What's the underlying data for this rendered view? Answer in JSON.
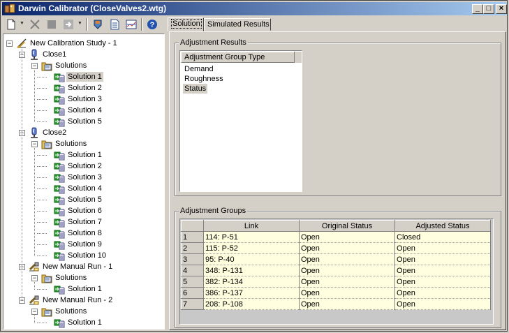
{
  "window": {
    "title": "Darwin Calibrator (CloseValves2.wtg)",
    "minimize": "_",
    "maximize": "□",
    "close": "×"
  },
  "toolbar": {
    "icons": [
      "new-document-icon",
      "new-dropdown-arrow-icon",
      "delete-icon",
      "stop-icon",
      "export-icon",
      "export-dropdown-arrow-icon",
      "compute-icon",
      "report-icon",
      "graph-icon",
      "help-icon"
    ]
  },
  "tree": {
    "root": "New Calibration Study - 1",
    "close1": "Close1",
    "close1_solutions": "Solutions",
    "close1_items": [
      "Solution 1",
      "Solution 2",
      "Solution 3",
      "Solution 4",
      "Solution 5"
    ],
    "close2": "Close2",
    "close2_solutions": "Solutions",
    "close2_items": [
      "Solution 1",
      "Solution 2",
      "Solution 3",
      "Solution 4",
      "Solution 5",
      "Solution 6",
      "Solution 7",
      "Solution 8",
      "Solution 9",
      "Solution 10"
    ],
    "manual1": "New Manual Run - 1",
    "manual1_solutions": "Solutions",
    "manual1_items": [
      "Solution 1"
    ],
    "manual2": "New Manual Run - 2",
    "manual2_solutions": "Solutions",
    "manual2_items": [
      "Solution 1"
    ],
    "expander_collapse": "−"
  },
  "tabs": {
    "solution": "Solution",
    "simulated": "Simulated Results"
  },
  "adjustment_results": {
    "label": "Adjustment Results",
    "header": "Adjustment Group Type",
    "items": [
      "Demand",
      "Roughness",
      "Status"
    ]
  },
  "adjustment_groups": {
    "label": "Adjustment Groups",
    "columns": [
      "Link",
      "Original Status",
      "Adjusted Status"
    ],
    "rows": [
      {
        "n": "1",
        "link": "114: P-51",
        "orig": "Open",
        "adj": "Closed"
      },
      {
        "n": "2",
        "link": "115: P-52",
        "orig": "Open",
        "adj": "Open"
      },
      {
        "n": "3",
        "link": "95: P-40",
        "orig": "Open",
        "adj": "Open"
      },
      {
        "n": "4",
        "link": "348: P-131",
        "orig": "Open",
        "adj": "Open"
      },
      {
        "n": "5",
        "link": "382: P-134",
        "orig": "Open",
        "adj": "Open"
      },
      {
        "n": "6",
        "link": "386: P-137",
        "orig": "Open",
        "adj": "Open"
      },
      {
        "n": "7",
        "link": "208: P-108",
        "orig": "Open",
        "adj": "Open"
      }
    ]
  },
  "colors": {
    "titlebar_start": "#0a246a",
    "titlebar_end": "#a6caf0",
    "face": "#d4d0c8",
    "grid_cell": "#ffffe0"
  }
}
